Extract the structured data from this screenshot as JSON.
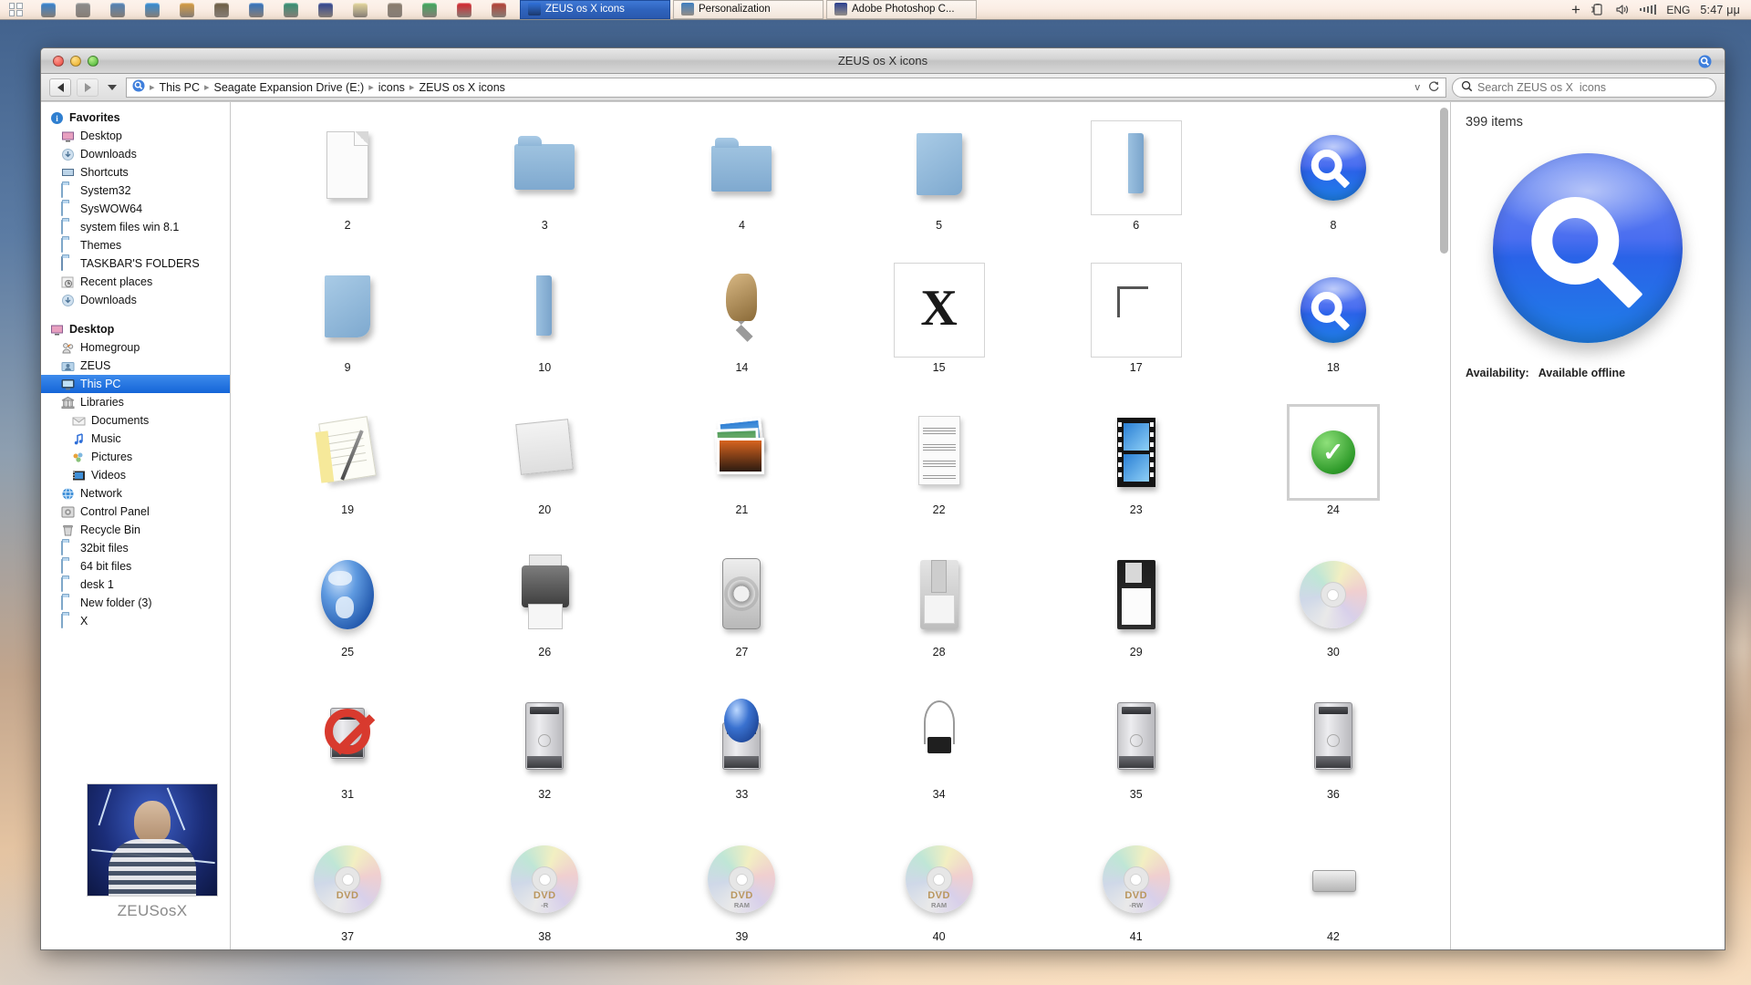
{
  "taskbar": {
    "start_label": "Start",
    "quick_icons": [
      {
        "name": "finder-icon",
        "color": "#2f7fd0"
      },
      {
        "name": "system-preferences-icon",
        "color": "#8a8a8a"
      },
      {
        "name": "display-icon",
        "color": "#4e7fb5"
      },
      {
        "name": "internet-explorer-icon",
        "color": "#2e8ad6"
      },
      {
        "name": "design-app-icon",
        "color": "#d89a3a"
      },
      {
        "name": "speaker-icon",
        "color": "#6b5a3e"
      },
      {
        "name": "app-blue-icon",
        "color": "#2d6fbe"
      },
      {
        "name": "compass-icon",
        "color": "#2f8f6f"
      },
      {
        "name": "photoshop-icon",
        "color": "#2b3f8f"
      },
      {
        "name": "notepad-icon",
        "color": "#e6d79a"
      },
      {
        "name": "apps-grid-icon",
        "color": "#8a7a6a"
      },
      {
        "name": "chrome-icon",
        "color": "#3aa757"
      },
      {
        "name": "opera-icon",
        "color": "#d81f26"
      },
      {
        "name": "mail-app-icon",
        "color": "#b53a2e"
      }
    ],
    "tasks": [
      {
        "label": "ZEUS os X  icons",
        "icon": "search-icon",
        "active": true,
        "icon_color": "#2f6fd8"
      },
      {
        "label": "Personalization",
        "icon": "display-icon",
        "active": false,
        "icon_color": "#3f7fbf"
      },
      {
        "label": "Adobe Photoshop C...",
        "icon": "photoshop-icon",
        "active": false,
        "icon_color": "#2b3f8f"
      }
    ],
    "tray": {
      "add_label": "+",
      "battery_icon": "battery-icon",
      "volume_icon": "speaker-icon",
      "network_icon": "signal-bars-icon",
      "language": "ENG",
      "clock": "5:47 μμ"
    }
  },
  "window": {
    "title": "ZEUS os X  icons",
    "lights": [
      "close-button",
      "minimize-button",
      "zoom-button"
    ],
    "title_search_icon": "search-icon"
  },
  "toolbar": {
    "back_label": "Back",
    "forward_label": "Forward",
    "recent_label": "Recent locations",
    "address_icon": "search-icon",
    "breadcrumbs": [
      "This PC",
      "Seagate Expansion Drive (E:)",
      "icons",
      "ZEUS os X  icons"
    ],
    "history_caret": "v",
    "refresh_icon": "refresh-icon",
    "search_icon": "search-icon",
    "search_placeholder": "Search ZEUS os X  icons",
    "search_value": ""
  },
  "sidebar": {
    "sections": [
      {
        "header": {
          "label": "Favorites",
          "icon": "favorites-icon"
        },
        "items": [
          {
            "label": "Desktop",
            "icon": "desktop-icon",
            "indent": 1
          },
          {
            "label": "Downloads",
            "icon": "downloads-icon",
            "indent": 1
          },
          {
            "label": "Shortcuts",
            "icon": "shortcuts-icon",
            "indent": 1
          },
          {
            "label": "System32",
            "icon": "folder-icon",
            "indent": 1
          },
          {
            "label": "SysWOW64",
            "icon": "folder-icon",
            "indent": 1
          },
          {
            "label": "system files win 8.1",
            "icon": "folder-icon",
            "indent": 1
          },
          {
            "label": "Themes",
            "icon": "folder-icon",
            "indent": 1
          },
          {
            "label": "TASKBAR'S FOLDERS",
            "icon": "folder-blue-icon",
            "indent": 1
          },
          {
            "label": "Recent places",
            "icon": "recent-places-icon",
            "indent": 1
          },
          {
            "label": "Downloads",
            "icon": "downloads-icon",
            "indent": 1
          }
        ]
      },
      {
        "header": {
          "label": "Desktop",
          "icon": "desktop-icon"
        },
        "items": [
          {
            "label": "Homegroup",
            "icon": "homegroup-icon",
            "indent": 1
          },
          {
            "label": "ZEUS",
            "icon": "user-folder-icon",
            "indent": 1
          },
          {
            "label": "This PC",
            "icon": "this-pc-icon",
            "indent": 1,
            "selected": true
          },
          {
            "label": "Libraries",
            "icon": "libraries-icon",
            "indent": 1
          },
          {
            "label": "Documents",
            "icon": "documents-icon",
            "indent": 2
          },
          {
            "label": "Music",
            "icon": "music-icon",
            "indent": 2
          },
          {
            "label": "Pictures",
            "icon": "pictures-icon",
            "indent": 2
          },
          {
            "label": "Videos",
            "icon": "videos-icon",
            "indent": 2
          },
          {
            "label": "Network",
            "icon": "network-icon",
            "indent": 1
          },
          {
            "label": "Control Panel",
            "icon": "control-panel-icon",
            "indent": 1
          },
          {
            "label": "Recycle Bin",
            "icon": "recycle-bin-icon",
            "indent": 1
          },
          {
            "label": "32bit files",
            "icon": "folder-icon",
            "indent": 1
          },
          {
            "label": "64 bit files",
            "icon": "folder-icon",
            "indent": 1
          },
          {
            "label": "desk 1",
            "icon": "folder-icon",
            "indent": 1
          },
          {
            "label": "New folder (3)",
            "icon": "folder-icon",
            "indent": 1
          },
          {
            "label": "X",
            "icon": "folder-icon",
            "indent": 1
          }
        ]
      }
    ],
    "avatar": {
      "name": "ZEUSosX",
      "image_alt": "user-photo-lightning"
    }
  },
  "content": {
    "items": [
      {
        "label": "2",
        "icon": "document-blank-icon"
      },
      {
        "label": "3",
        "icon": "mac-folder-icon"
      },
      {
        "label": "4",
        "icon": "mac-folder-flat-icon"
      },
      {
        "label": "5",
        "icon": "blue-sheet-icon"
      },
      {
        "label": "6",
        "icon": "blue-sheet-thin-icon",
        "framed": true
      },
      {
        "label": "8",
        "icon": "magnifier-icon"
      },
      {
        "label": "9",
        "icon": "blue-sheet-fold-icon"
      },
      {
        "label": "10",
        "icon": "blue-sheet-thin-icon"
      },
      {
        "label": "14",
        "icon": "chess-knight-icon"
      },
      {
        "label": "15",
        "icon": "x-letter-icon",
        "framed": true
      },
      {
        "label": "17",
        "icon": "corner-frame-icon",
        "framed": true
      },
      {
        "label": "18",
        "icon": "magnifier-icon"
      },
      {
        "label": "19",
        "icon": "notes-pen-icon"
      },
      {
        "label": "20",
        "icon": "mail-stamp-icon"
      },
      {
        "label": "21",
        "icon": "photos-stack-icon"
      },
      {
        "label": "22",
        "icon": "sheet-music-icon"
      },
      {
        "label": "23",
        "icon": "film-strip-icon"
      },
      {
        "label": "24",
        "icon": "green-check-icon",
        "framed": true,
        "selected": true
      },
      {
        "label": "25",
        "icon": "globe-icon"
      },
      {
        "label": "26",
        "icon": "printer-icon"
      },
      {
        "label": "27",
        "icon": "gears-panel-icon"
      },
      {
        "label": "28",
        "icon": "zip-disk-icon"
      },
      {
        "label": "29",
        "icon": "floppy-disk-icon"
      },
      {
        "label": "30",
        "icon": "cd-disc-icon"
      },
      {
        "label": "31",
        "icon": "no-entry-drive-icon"
      },
      {
        "label": "32",
        "icon": "hard-drive-icon"
      },
      {
        "label": "33",
        "icon": "network-drive-icon"
      },
      {
        "label": "34",
        "icon": "caliper-chip-icon"
      },
      {
        "label": "35",
        "icon": "hard-drive-icon"
      },
      {
        "label": "36",
        "icon": "hard-drive-icon"
      },
      {
        "label": "37",
        "icon": "dvd-disc-icon",
        "dvd": "DVD",
        "dvd_sub": ""
      },
      {
        "label": "38",
        "icon": "dvd-r-disc-icon",
        "dvd": "DVD",
        "dvd_sub": "-R"
      },
      {
        "label": "39",
        "icon": "dvd-ram-disc-icon",
        "dvd": "DVD",
        "dvd_sub": "RAM"
      },
      {
        "label": "40",
        "icon": "dvd-ram-disc-icon",
        "dvd": "DVD",
        "dvd_sub": "RAM"
      },
      {
        "label": "41",
        "icon": "dvd-rw-disc-icon",
        "dvd": "DVD",
        "dvd_sub": "-RW"
      },
      {
        "label": "42",
        "icon": "mac-mini-icon"
      }
    ]
  },
  "preview": {
    "count": "399 items",
    "image_icon": "magnifier-icon",
    "availability_key": "Availability:",
    "availability_value": "Available offline"
  },
  "colors": {
    "accent": "#1565d8",
    "taskbar_active": "#2f63bd",
    "folder_blue": "#7fa9cf",
    "check_green": "#2f9b2a"
  }
}
